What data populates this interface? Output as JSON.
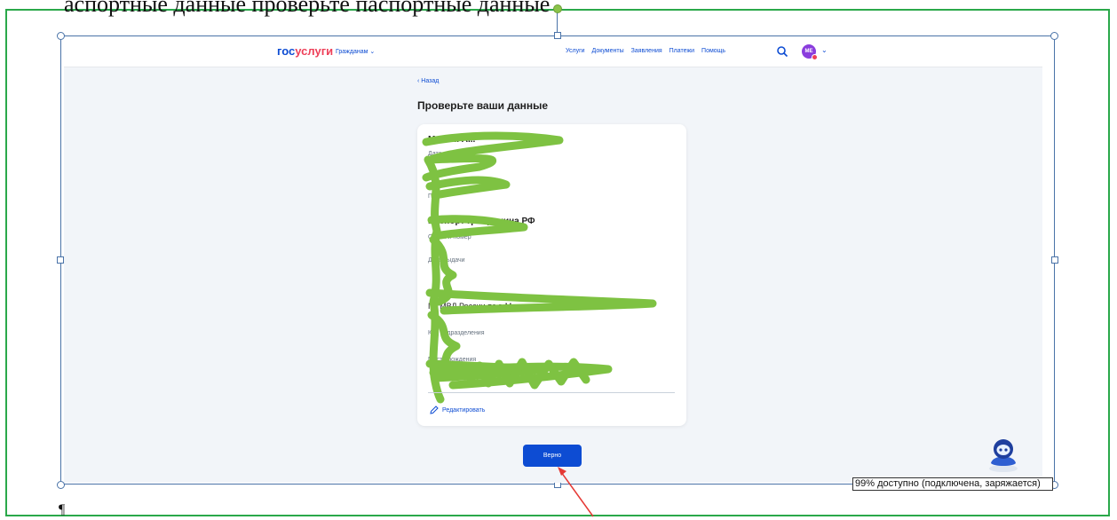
{
  "document": {
    "line_above": "аспортные данные проверьте паспортные данные",
    "pilcrow": "¶",
    "status_text": "99% доступно (подключена, заряжается)"
  },
  "topbar": {
    "logo_part1": "гос",
    "logo_part2": "услуги",
    "citizens_menu": "Гражданам ⌄",
    "nav": [
      "Услуги",
      "Документы",
      "Заявления",
      "Платежи",
      "Помощь"
    ],
    "avatar_initials": "МЕ",
    "search_icon": "search-icon",
    "chevron": "⌄"
  },
  "page": {
    "back_link": "‹ Назад",
    "title": "Проверьте ваши данные"
  },
  "card": {
    "name_value": "М... Б... А...",
    "birth_label": "Дата рождения",
    "gender_label": "Пол",
    "passport_title": "Паспорт гражданина РФ",
    "series_label": "Серия и номер",
    "issue_date_label": "Дата выдачи",
    "issued_by_label": "Кем выдан",
    "issued_by_value": "ГУ МВД России по г. Москве",
    "code_label": "Код подразделения",
    "birthplace_label": "Место рождения",
    "edit_link": "Редактировать"
  },
  "actions": {
    "confirm": "Верно"
  },
  "colors": {
    "brand_blue": "#0d4cd3",
    "brand_red": "#ee3f58",
    "scribble": "#7ec242",
    "frame_green": "#2aa84a",
    "arrow_red": "#e53935"
  }
}
